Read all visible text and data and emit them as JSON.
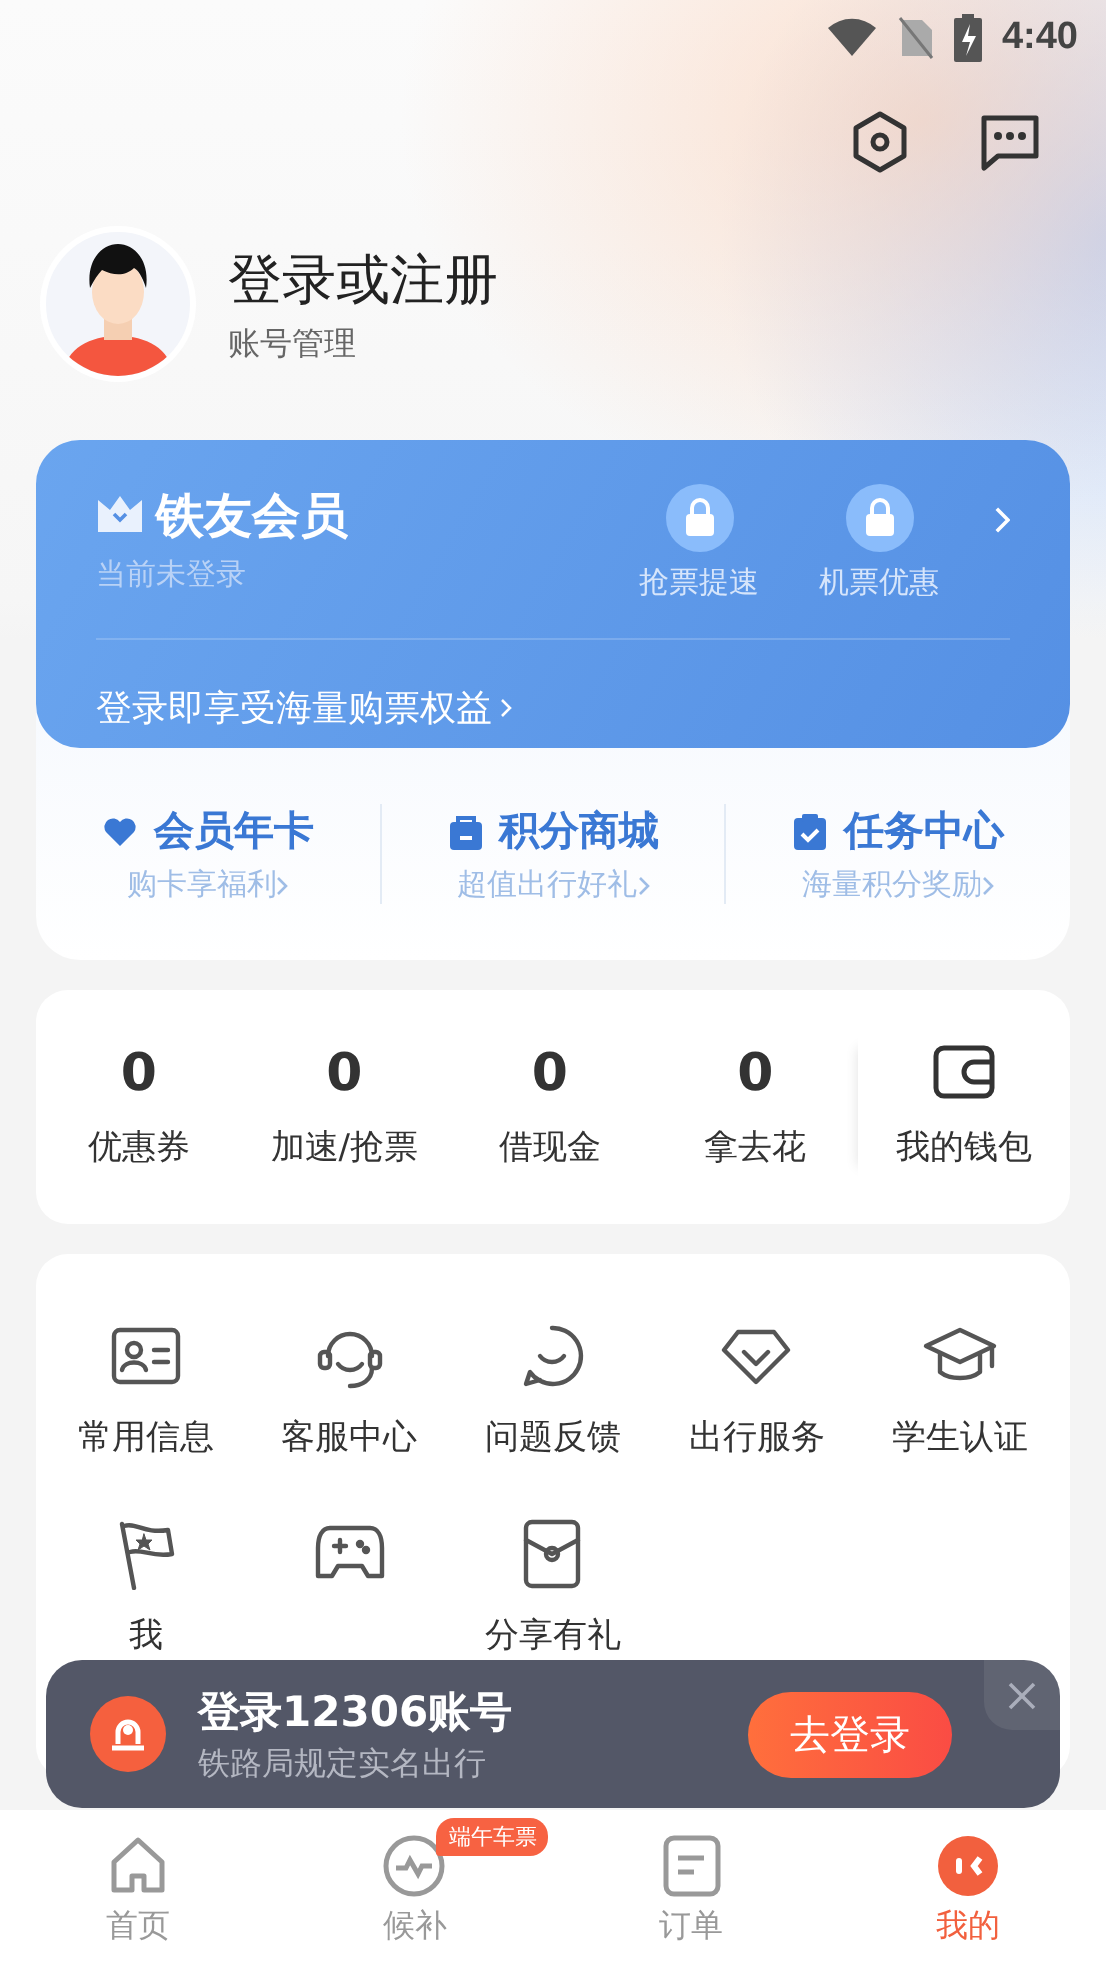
{
  "status_bar": {
    "time": "4:40"
  },
  "header": {
    "title": "登录或注册",
    "subtitle": "账号管理"
  },
  "membership": {
    "title": "铁友会员",
    "status": "当前未登录",
    "perks": [
      {
        "label": "抢票提速",
        "locked": true
      },
      {
        "label": "机票优惠",
        "locked": true
      }
    ],
    "promo": "登录即享受海量购票权益"
  },
  "member_links": [
    {
      "kind": "heart",
      "title": "会员年卡",
      "subtitle": "购卡享福利"
    },
    {
      "kind": "bag",
      "title": "积分商城",
      "subtitle": "超值出行好礼"
    },
    {
      "kind": "clipboard",
      "title": "任务中心",
      "subtitle": "海量积分奖励"
    }
  ],
  "stats": [
    {
      "value": "0",
      "label": "优惠券"
    },
    {
      "value": "0",
      "label": "加速/抢票"
    },
    {
      "value": "0",
      "label": "借现金"
    },
    {
      "value": "0",
      "label": "拿去花"
    }
  ],
  "wallet": {
    "label": "我的钱包"
  },
  "services": [
    {
      "kind": "id-card",
      "label": "常用信息"
    },
    {
      "kind": "headset",
      "label": "客服中心"
    },
    {
      "kind": "chat",
      "label": "问题反馈"
    },
    {
      "kind": "diamond",
      "label": "出行服务"
    },
    {
      "kind": "cap",
      "label": "学生认证"
    },
    {
      "kind": "flag",
      "label": "我"
    },
    {
      "kind": "gamepad"
    },
    {
      "kind": "envelope",
      "label": "分享有礼"
    }
  ],
  "toast": {
    "title": "登录12306账号",
    "subtitle": "铁路局规定实名出行",
    "button": "去登录"
  },
  "tabs": [
    {
      "kind": "home",
      "label": "首页",
      "selected": false
    },
    {
      "kind": "pulse",
      "label": "候补",
      "selected": false,
      "badge": "端午车票"
    },
    {
      "kind": "order",
      "label": "订单",
      "selected": false
    },
    {
      "kind": "me",
      "label": "我的",
      "selected": true
    }
  ]
}
